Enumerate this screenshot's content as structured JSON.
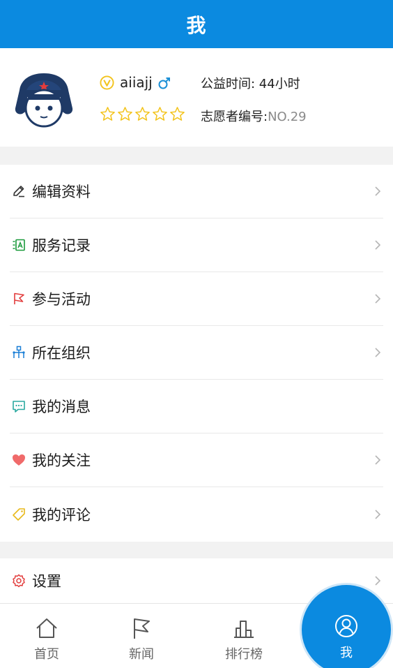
{
  "header": {
    "title": "我"
  },
  "profile": {
    "username": "aiiajj",
    "stars_filled": 0,
    "stars_total": 5,
    "hours_label": "公益时间: 44小时",
    "volunteer_no_label": "志愿者编号:",
    "volunteer_no_value": "NO.29"
  },
  "menu": [
    {
      "label": "编辑资料",
      "icon": "edit-icon",
      "has_chevron": true
    },
    {
      "label": "服务记录",
      "icon": "service-record-icon",
      "has_chevron": true
    },
    {
      "label": "参与活动",
      "icon": "flag-icon",
      "has_chevron": true
    },
    {
      "label": "所在组织",
      "icon": "organization-icon",
      "has_chevron": true
    },
    {
      "label": "我的消息",
      "icon": "message-icon",
      "has_chevron": false
    },
    {
      "label": "我的关注",
      "icon": "heart-icon",
      "has_chevron": true
    },
    {
      "label": "我的评论",
      "icon": "tag-icon",
      "has_chevron": true
    }
  ],
  "settings": {
    "label": "设置",
    "icon": "gear-icon"
  },
  "tabs": [
    {
      "label": "首页",
      "icon": "home-icon"
    },
    {
      "label": "新闻",
      "icon": "flag-icon"
    },
    {
      "label": "排行榜",
      "icon": "ranking-icon"
    },
    {
      "label": "我",
      "icon": "user-icon",
      "active": true
    }
  ],
  "colors": {
    "primary": "#0b8ae0",
    "star": "#f3c41e",
    "gender": "#1a8fd6",
    "edit": "#333333",
    "service": "#1a9a3b",
    "activity": "#e23c3c",
    "organization": "#1a7fd6",
    "message": "#2aa9a0",
    "heart": "#f06a6a",
    "comment": "#e8b91c",
    "settings": "#e23c3c"
  }
}
